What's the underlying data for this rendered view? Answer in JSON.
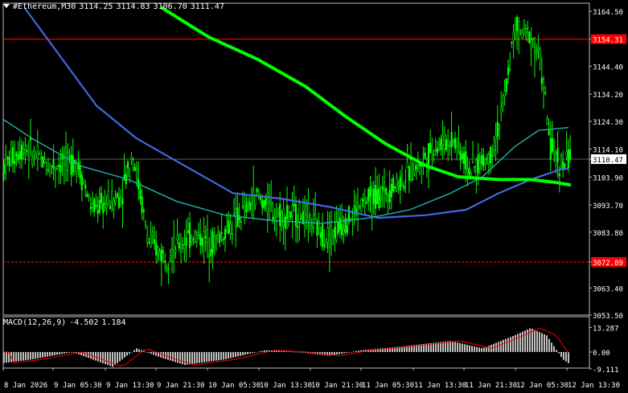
{
  "header": {
    "symbol_tf": "#Ethereum,M30",
    "open": "3114.25",
    "high": "3114.83",
    "low": "3106.70",
    "close": "3111.47"
  },
  "macd": {
    "label": "MACD(12,26,9)",
    "value1": "-4.502",
    "value2": "1.184",
    "axis": [
      "13.287",
      "0.00",
      "-9.111"
    ]
  },
  "price_axis": [
    "3164.50",
    "3154.31",
    "3144.40",
    "3134.20",
    "3124.30",
    "3114.10",
    "3110.47",
    "3103.90",
    "3093.70",
    "3083.80",
    "3072.89",
    "3063.40",
    "3053.50"
  ],
  "levels": {
    "upper": "3154.31",
    "lower": "3072.89",
    "current": "3110.47"
  },
  "time_axis": [
    "8 Jan 2026",
    "9 Jan 05:30",
    "9 Jan 13:30",
    "9 Jan 21:30",
    "10 Jan 05:30",
    "10 Jan 13:30",
    "10 Jan 21:30",
    "11 Jan 05:30",
    "11 Jan 13:30",
    "11 Jan 21:30",
    "12 Jan 05:30",
    "12 Jan 13:30"
  ],
  "colors": {
    "background": "#000000",
    "candle": "#00ff00",
    "level_line": "#ff0000",
    "ma_fast": "#4169e1",
    "ma_mid": "#20b2aa",
    "ma_slow": "#00ff00",
    "macd_hist": "#c0c0c0",
    "macd_signal": "#ff0000"
  }
}
